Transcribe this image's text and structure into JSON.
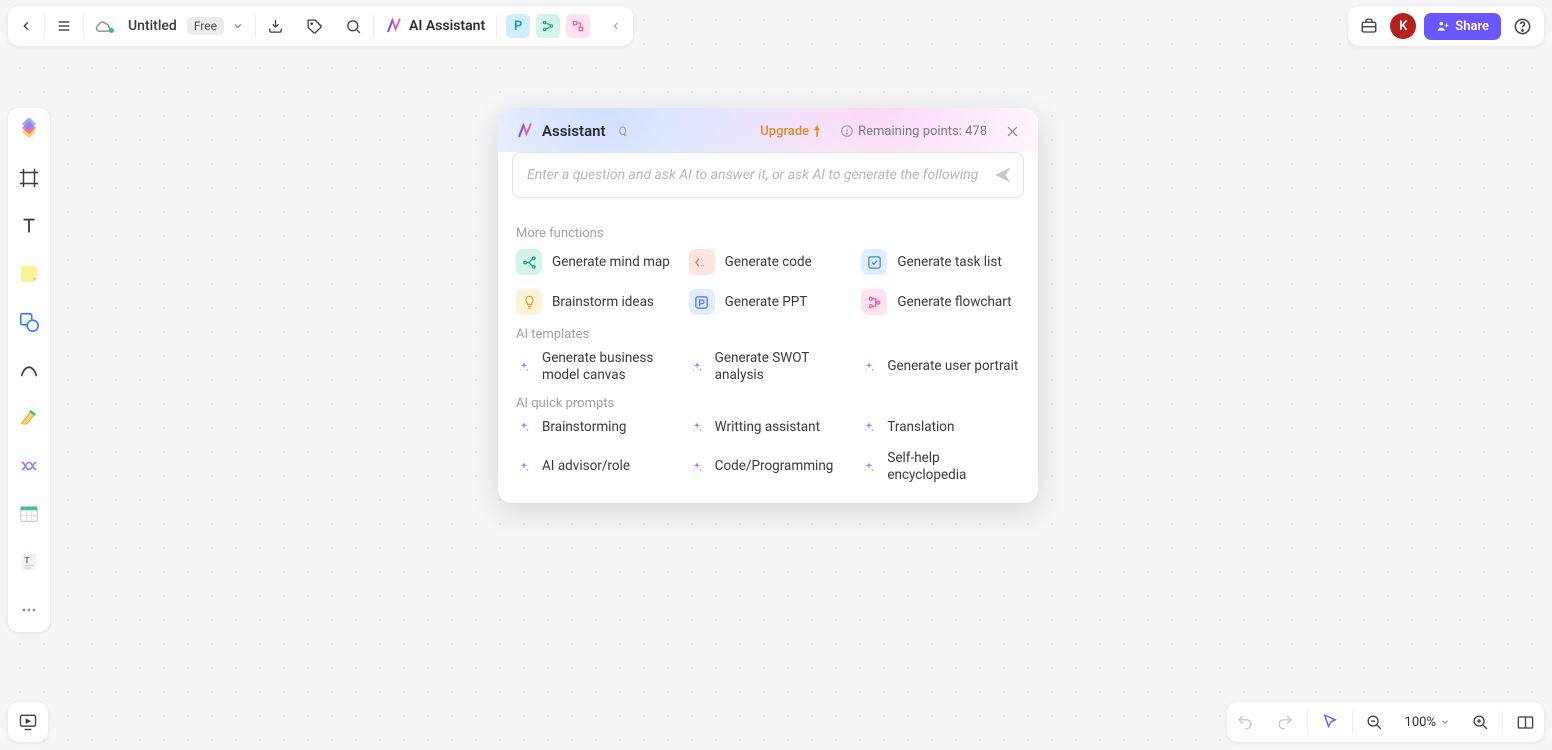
{
  "topbar": {
    "doc_title": "Untitled",
    "plan_badge": "Free",
    "ai_label": "AI Assistant"
  },
  "topright": {
    "avatar_initial": "K",
    "share_label": "Share"
  },
  "dialog": {
    "title": "Assistant",
    "shortcut": "Q",
    "upgrade": "Upgrade",
    "points_label": "Remaining points: 478",
    "input_placeholder": "Enter a question and ask AI to answer it, or ask AI to generate the following",
    "section_more": "More functions",
    "section_templates": "AI templates",
    "section_prompts": "AI quick prompts",
    "more": [
      {
        "label": "Generate mind map",
        "bg": "#d4f4e8",
        "fg": "#1aa879",
        "glyph": "branch"
      },
      {
        "label": "Generate code",
        "bg": "#ffe3dd",
        "fg": "#e06b4f",
        "glyph": "code"
      },
      {
        "label": "Generate task list",
        "bg": "#dfefff",
        "fg": "#3a87e6",
        "glyph": "check"
      },
      {
        "label": "Brainstorm ideas",
        "bg": "#fff3d6",
        "fg": "#e6a421",
        "glyph": "bulb"
      },
      {
        "label": "Generate PPT",
        "bg": "#e0ecff",
        "fg": "#4a77e6",
        "glyph": "ppt"
      },
      {
        "label": "Generate flowchart",
        "bg": "#ffe2ef",
        "fg": "#e85ca3",
        "glyph": "flow"
      }
    ],
    "templates": [
      {
        "label": "Generate business model canvas"
      },
      {
        "label": "Generate SWOT analysis"
      },
      {
        "label": "Generate user portrait"
      }
    ],
    "prompts": [
      {
        "label": "Brainstorming"
      },
      {
        "label": "Writting assistant"
      },
      {
        "label": "Translation"
      },
      {
        "label": "AI advisor/role"
      },
      {
        "label": "Code/Programming"
      },
      {
        "label": "Self-help encyclopedia"
      }
    ]
  },
  "bottomright": {
    "zoom": "100%"
  }
}
